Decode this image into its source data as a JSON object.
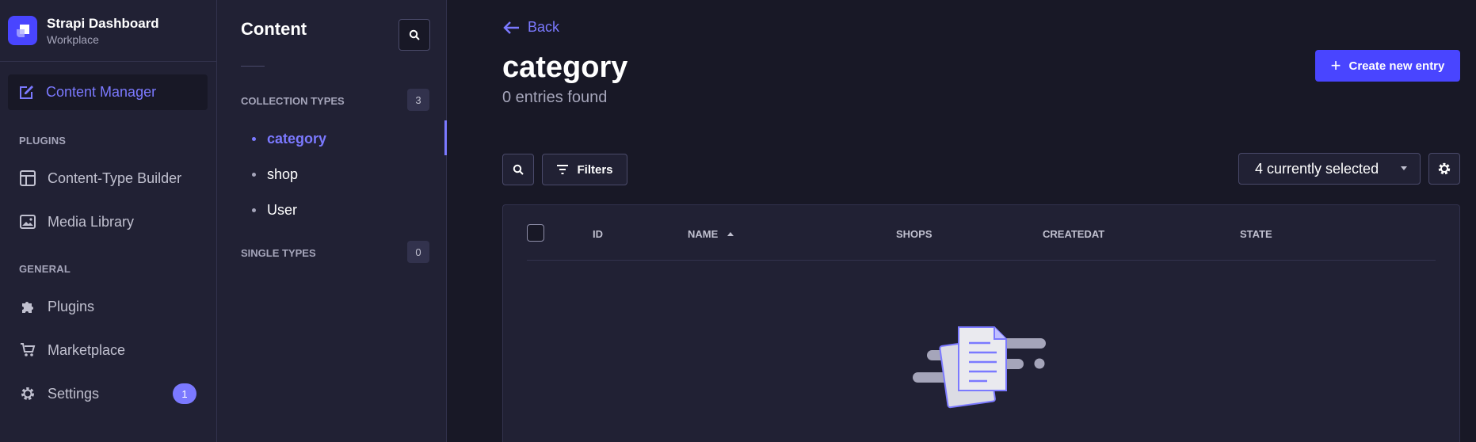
{
  "brand": {
    "title": "Strapi Dashboard",
    "subtitle": "Workplace"
  },
  "sidebar": {
    "active": {
      "label": "Content Manager",
      "icon": "feather-icon"
    },
    "plugins_heading": "PLUGINS",
    "plugins": [
      {
        "label": "Content-Type Builder",
        "icon": "layout-icon"
      },
      {
        "label": "Media Library",
        "icon": "image-icon"
      }
    ],
    "general_heading": "GENERAL",
    "general": [
      {
        "label": "Plugins",
        "icon": "puzzle-icon"
      },
      {
        "label": "Marketplace",
        "icon": "cart-icon"
      },
      {
        "label": "Settings",
        "icon": "gear-icon",
        "badge": "1"
      }
    ]
  },
  "subnav": {
    "title": "Content",
    "collection_heading": "COLLECTION TYPES",
    "collection_count": "3",
    "collection_items": [
      "category",
      "shop",
      "User"
    ],
    "single_heading": "SINGLE TYPES",
    "single_count": "0"
  },
  "main": {
    "back_label": "Back",
    "title": "category",
    "subtitle": "0 entries found",
    "create_label": "Create new entry",
    "filters_label": "Filters",
    "columns_select": "4 currently selected",
    "columns": [
      "ID",
      "NAME",
      "SHOPS",
      "CREATEDAT",
      "STATE"
    ]
  },
  "colors": {
    "accent": "#4945ff",
    "accent_light": "#7b79ff",
    "bg": "#181826",
    "panel": "#212134"
  }
}
